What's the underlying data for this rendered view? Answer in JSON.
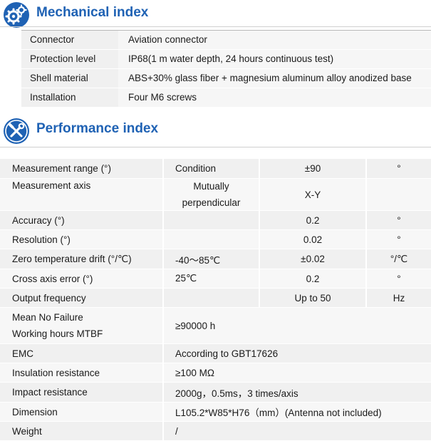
{
  "mechanical": {
    "title": "Mechanical index",
    "icon": "gears-icon",
    "rows": [
      {
        "label": "Connector",
        "value": "Aviation connector"
      },
      {
        "label": "Protection level",
        "value": "IP68(1 m water depth, 24 hours continuous test)"
      },
      {
        "label": "Shell material",
        "value": "ABS+30% glass fiber + magnesium aluminum alloy anodized base"
      },
      {
        "label": "Installation",
        "value": "Four M6 screws"
      }
    ]
  },
  "performance": {
    "title": "Performance index",
    "icon": "tools-icon",
    "rows": [
      {
        "name": "Measurement range (°)",
        "condition": "Condition",
        "value": "±90",
        "unit": "°"
      },
      {
        "name": "Measurement axis",
        "condition_lines": [
          "Mutually",
          "perpendicular"
        ],
        "value": "X-Y",
        "unit": ""
      },
      {
        "name": "Accuracy (°)",
        "condition": "",
        "value": "0.2",
        "unit": "°"
      },
      {
        "name": "Resolution (°)",
        "condition": "",
        "value": "0.02",
        "unit": "°"
      },
      {
        "name": "Zero temperature drift (°/℃)",
        "condition": "-40～85℃",
        "value": "±0.02",
        "unit": "°/℃"
      },
      {
        "name": "Cross axis error (°)",
        "condition": "25℃",
        "value": "0.2",
        "unit": "°"
      },
      {
        "name": "Output frequency",
        "condition": "",
        "value": "Up to 50",
        "unit": "Hz"
      },
      {
        "name_lines": [
          "Mean No Failure",
          "Working hours MTBF"
        ],
        "wide": "≥90000 h"
      },
      {
        "name": "EMC",
        "wide": "According to GBT17626"
      },
      {
        "name": "Insulation resistance",
        "wide": "≥100 MΩ"
      },
      {
        "name": "Impact resistance",
        "wide": "2000g，0.5ms，3 times/axis"
      },
      {
        "name": "Dimension",
        "wide": "L105.2*W85*H76（mm）(Antenna not included)"
      },
      {
        "name": "Weight",
        "wide": "/"
      }
    ]
  }
}
